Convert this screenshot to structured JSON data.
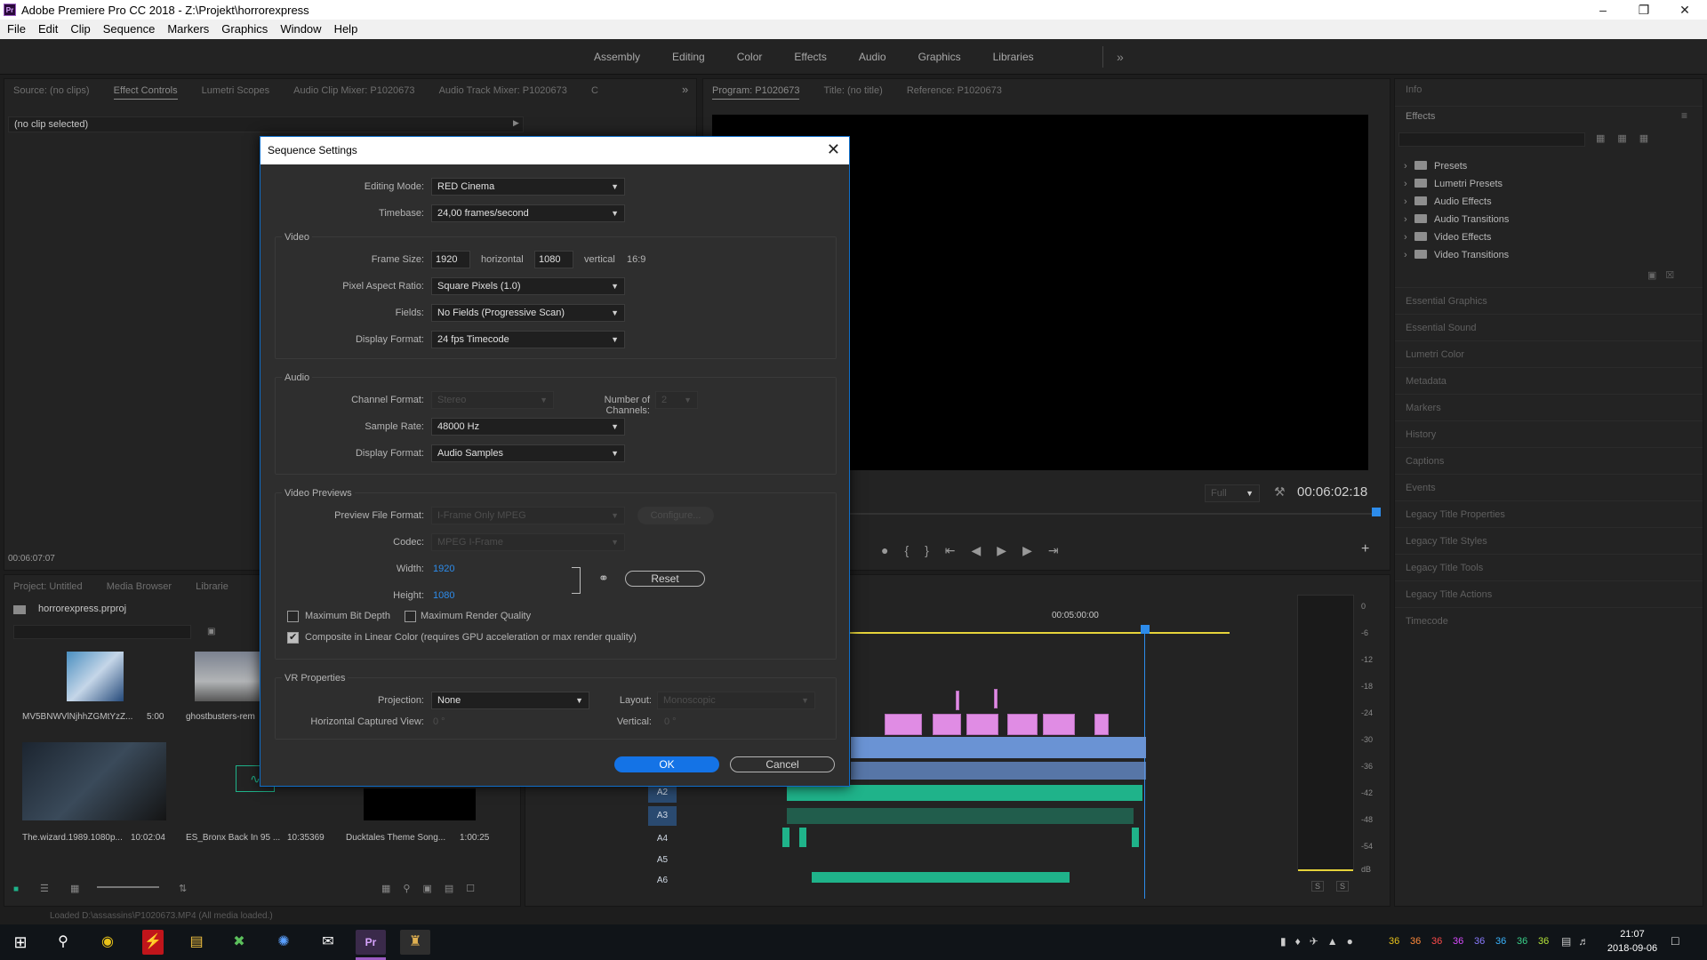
{
  "window": {
    "title": "Adobe Premiere Pro CC 2018 - Z:\\Projekt\\horrorexpress",
    "app_badge": "Pr"
  },
  "menu": [
    "File",
    "Edit",
    "Clip",
    "Sequence",
    "Markers",
    "Graphics",
    "Window",
    "Help"
  ],
  "workspaces": [
    "Assembly",
    "Editing",
    "Color",
    "Effects",
    "Audio",
    "Graphics",
    "Libraries"
  ],
  "source_panel": {
    "tabs": [
      "Source: (no clips)",
      "Effect Controls",
      "Lumetri Scopes",
      "Audio Clip Mixer: P1020673",
      "Audio Track Mixer: P1020673",
      "C"
    ],
    "no_clip": "(no clip selected)",
    "timecode": "00:06:07:07"
  },
  "program_panel": {
    "tabs": [
      "Program: P1020673",
      "Title: (no title)",
      "Reference: P1020673"
    ],
    "zoom": "Full",
    "timecode": "00:06:02:18"
  },
  "project_panel": {
    "tabs": [
      "Project: Untitled",
      "Media Browser",
      "Librarie"
    ],
    "project_file": "horrorexpress.prproj",
    "items": [
      {
        "name": "MV5BNWVlNjhhZGMtYzZ...",
        "duration": "5:00"
      },
      {
        "name": "ghostbusters-rem",
        "duration": ""
      },
      {
        "name": "The.wizard.1989.1080p...",
        "duration": "10:02:04"
      },
      {
        "name": "ES_Bronx Back In 95 ...",
        "duration": "10:35369"
      },
      {
        "name": "Ducktales Theme Song...",
        "duration": "1:00:25"
      }
    ]
  },
  "timeline": {
    "ruler_time": "00:05:00:00",
    "audio_tracks": [
      "A2",
      "A3",
      "A4",
      "A5",
      "A6"
    ]
  },
  "audio_meter": {
    "scale": [
      "0",
      "-6",
      "-12",
      "-18",
      "-24",
      "-30",
      "-36",
      "-42",
      "-48",
      "-54",
      "dB"
    ],
    "solo_buttons": [
      "S",
      "S"
    ]
  },
  "right_panel": {
    "info": "Info",
    "effects_title": "Effects",
    "effects_tree": [
      "Presets",
      "Lumetri Presets",
      "Audio Effects",
      "Audio Transitions",
      "Video Effects",
      "Video Transitions"
    ],
    "collapsed_panels": [
      "Essential Graphics",
      "Essential Sound",
      "Lumetri Color",
      "Metadata",
      "Markers",
      "History",
      "Captions",
      "Events",
      "Legacy Title Properties",
      "Legacy Title Styles",
      "Legacy Title Tools",
      "Legacy Title Actions",
      "Timecode"
    ]
  },
  "status_bar": "Loaded D:\\assassins\\P1020673.MP4 (All media loaded.)",
  "dialog": {
    "title": "Sequence Settings",
    "editing_mode_label": "Editing Mode:",
    "editing_mode": "RED Cinema",
    "timebase_label": "Timebase:",
    "timebase": "24,00  frames/second",
    "video": {
      "title": "Video",
      "frame_size_label": "Frame Size:",
      "width": "1920",
      "horizontal": "horizontal",
      "height": "1080",
      "vertical": "vertical",
      "aspect": "16:9",
      "par_label": "Pixel Aspect Ratio:",
      "par": "Square Pixels (1.0)",
      "fields_label": "Fields:",
      "fields": "No Fields (Progressive Scan)",
      "display_format_label": "Display Format:",
      "display_format": "24 fps Timecode"
    },
    "audio": {
      "title": "Audio",
      "channel_format_label": "Channel Format:",
      "channel_format": "Stereo",
      "num_channels_label": "Number of Channels:",
      "num_channels": "2",
      "sample_rate_label": "Sample Rate:",
      "sample_rate": "48000 Hz",
      "display_format_label": "Display Format:",
      "display_format": "Audio Samples"
    },
    "previews": {
      "title": "Video Previews",
      "preview_format_label": "Preview File Format:",
      "preview_format": "I-Frame Only MPEG",
      "configure": "Configure...",
      "codec_label": "Codec:",
      "codec": "MPEG I-Frame",
      "width_label": "Width:",
      "width": "1920",
      "height_label": "Height:",
      "height": "1080",
      "reset": "Reset",
      "max_bit_depth": "Maximum Bit Depth",
      "max_render_quality": "Maximum Render Quality",
      "linear_color": "Composite in Linear Color (requires GPU acceleration or max render quality)"
    },
    "vr": {
      "title": "VR Properties",
      "projection_label": "Projection:",
      "projection": "None",
      "layout_label": "Layout:",
      "layout": "Monoscopic",
      "hcv_label": "Horizontal Captured View:",
      "hcv": "0 °",
      "vertical_label": "Vertical:",
      "vertical": "0 °"
    },
    "ok": "OK",
    "cancel": "Cancel"
  },
  "taskbar": {
    "tray_numbers": [
      "36",
      "36",
      "36",
      "36",
      "36",
      "36",
      "36",
      "36"
    ],
    "tray_colors": [
      "#e8c21a",
      "#ff8a3a",
      "#ff4b4b",
      "#d94bff",
      "#8a7bff",
      "#3ab4ff",
      "#3ad18a",
      "#b8e83a"
    ],
    "time": "21:07",
    "date": "2018-09-06"
  },
  "colors": {
    "accent_blue": "#1473e6",
    "clip_video": "#e08ce4",
    "clip_audio_a1": "#6a93d4",
    "clip_audio": "#1fb38a",
    "playhead": "#2d8ceb"
  }
}
